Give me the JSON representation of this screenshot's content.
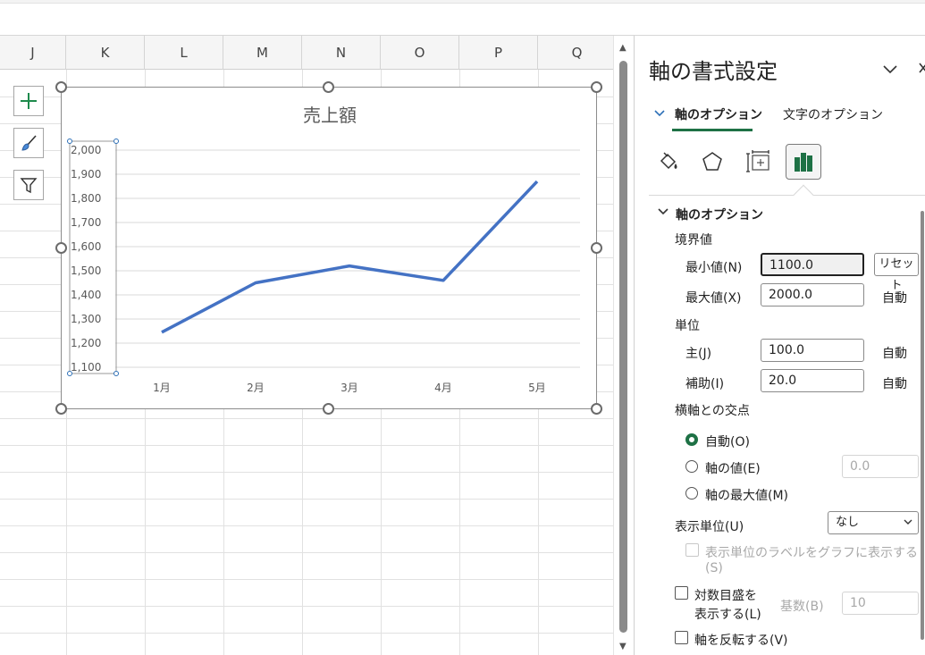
{
  "spreadsheet": {
    "columns": [
      "J",
      "K",
      "L",
      "M",
      "N",
      "O",
      "P",
      "Q"
    ]
  },
  "chart_data": {
    "type": "line",
    "title": "売上額",
    "categories": [
      "1月",
      "2月",
      "3月",
      "4月",
      "5月"
    ],
    "series": [
      {
        "values": [
          1245,
          1450,
          1520,
          1460,
          1870
        ]
      }
    ],
    "ylim": [
      1100,
      2000
    ],
    "yticks": [
      "2,000",
      "1,900",
      "1,800",
      "1,700",
      "1,600",
      "1,500",
      "1,400",
      "1,300",
      "1,200",
      "1,100"
    ],
    "grid": true,
    "line_color": "#4472c4"
  },
  "pane": {
    "title": "軸の書式設定",
    "tabs": [
      "軸のオプション",
      "文字のオプション"
    ],
    "section_title": "軸のオプション",
    "bounds": {
      "heading": "境界値",
      "min_label": "最小値(N)",
      "min_value": "1100.0",
      "reset_label": "リセット",
      "max_label": "最大値(X)",
      "max_value": "2000.0",
      "max_state": "自動"
    },
    "units": {
      "heading": "単位",
      "major_label": "主(J)",
      "major_value": "100.0",
      "major_state": "自動",
      "minor_label": "補助(I)",
      "minor_value": "20.0",
      "minor_state": "自動"
    },
    "crosses": {
      "heading": "横軸との交点",
      "auto": "自動(O)",
      "axis_value": "軸の値(E)",
      "axis_value_input": "0.0",
      "max_value": "軸の最大値(M)"
    },
    "display_units": {
      "label": "表示単位(U)",
      "selected": "なし",
      "show_label_line1": "表示単位のラベルをグラフに表示する",
      "show_label_line2": "(S)"
    },
    "log_scale": {
      "line1": "対数目盛を",
      "line2": "表示する(L)",
      "base_label": "基数(B)",
      "base_value": "10"
    },
    "reverse": "軸を反転する(V)"
  }
}
